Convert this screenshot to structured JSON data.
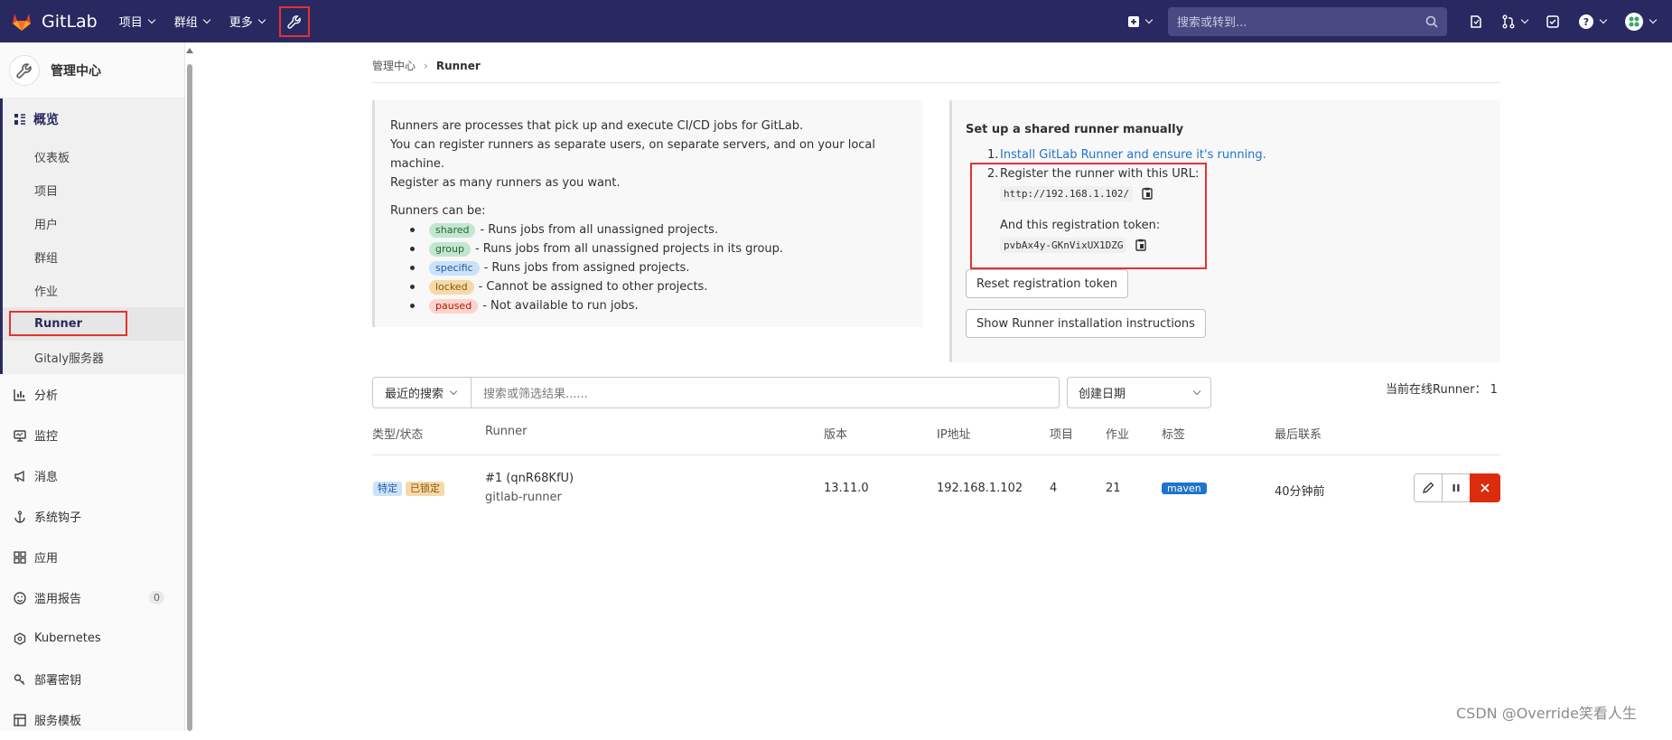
{
  "navbar": {
    "brand": "GitLab",
    "menu": [
      "项目",
      "群组",
      "更多"
    ],
    "search_placeholder": "搜索或转到..."
  },
  "sidebar": {
    "title": "管理中心",
    "overview": "概览",
    "overview_items": [
      "仪表板",
      "项目",
      "用户",
      "群组",
      "作业",
      "Runner",
      "Gitaly服务器"
    ],
    "items": [
      {
        "label": "分析",
        "icon": "chart-icon"
      },
      {
        "label": "监控",
        "icon": "monitor-icon"
      },
      {
        "label": "消息",
        "icon": "megaphone-icon"
      },
      {
        "label": "系统钩子",
        "icon": "anchor-icon"
      },
      {
        "label": "应用",
        "icon": "apps-icon"
      },
      {
        "label": "滥用报告",
        "icon": "smile-icon",
        "count": "0"
      },
      {
        "label": "Kubernetes",
        "icon": "cloud-icon"
      },
      {
        "label": "部署密钥",
        "icon": "key-icon"
      },
      {
        "label": "服务模板",
        "icon": "template-icon"
      }
    ]
  },
  "breadcrumb": {
    "parent": "管理中心",
    "current": "Runner"
  },
  "info": {
    "intro": [
      "Runners are processes that pick up and execute CI/CD jobs for GitLab.",
      "You can register runners as separate users, on separate servers, and on your local machine.",
      "Register as many runners as you want."
    ],
    "can_be": "Runners can be:",
    "types": [
      {
        "badge": "shared",
        "text": "- Runs jobs from all unassigned projects."
      },
      {
        "badge": "group",
        "text": "- Runs jobs from all unassigned projects in its group."
      },
      {
        "badge": "specific",
        "text": "- Runs jobs from assigned projects."
      },
      {
        "badge": "locked",
        "text": "- Cannot be assigned to other projects."
      },
      {
        "badge": "paused",
        "text": "- Not available to run jobs."
      }
    ]
  },
  "setup": {
    "title": "Set up a shared runner manually",
    "step1_num": "1.",
    "step1_link": "Install GitLab Runner and ensure it's running.",
    "step2_num": "2.",
    "step2": "Register the runner with this URL:",
    "url": "http://192.168.1.102/",
    "token_label": "And this registration token:",
    "token": "pvbAx4y-GKnVixUX1DZG",
    "reset_button": "Reset registration token",
    "instructions_button": "Show Runner installation instructions"
  },
  "filter": {
    "recent": "最近的搜索",
    "placeholder": "搜索或筛选结果......",
    "sort": "创建日期",
    "online": "当前在线Runner：  1"
  },
  "table": {
    "headers": [
      "类型/状态",
      "Runner",
      "版本",
      "IP地址",
      "项目",
      "作业",
      "标签",
      "最后联系"
    ],
    "row": {
      "type_badge": "特定",
      "status_badge": "已锁定",
      "runner_link": "#1 (qnR68KfU)",
      "runner_desc": "gitlab-runner",
      "version": "13.11.0",
      "ip": "192.168.1.102",
      "projects": "4",
      "jobs": "21",
      "tag": "maven",
      "last_contact": "40分钟前"
    }
  },
  "watermark": "CSDN @Override笑看人生",
  "colors": {
    "navbar": "#292961",
    "link": "#1f75cb",
    "danger": "#dd2b0e",
    "highlight": "#e5322f"
  }
}
